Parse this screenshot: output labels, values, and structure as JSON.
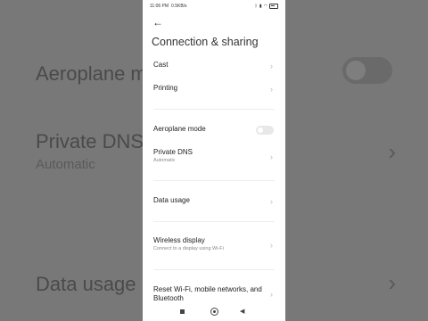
{
  "background": {
    "aeroplane_mode": "Aeroplane m",
    "private_dns": "Private DNS",
    "private_dns_value": "Automatic",
    "data_usage": "Data usage"
  },
  "status_bar": {
    "time": "11:06 PM",
    "speed": "0.5KB/s"
  },
  "header": {
    "back_icon": "←",
    "title": "Connection & sharing"
  },
  "items": [
    {
      "label": "Cast"
    },
    {
      "label": "Printing"
    },
    {
      "label": "Aeroplane mode",
      "toggle": false
    },
    {
      "label": "Private DNS",
      "sub": "Automatic"
    },
    {
      "label": "Data usage"
    },
    {
      "label": "Wireless display",
      "sub": "Connect to a display using Wi-Fi"
    },
    {
      "label": "Reset Wi-Fi, mobile networks, and",
      "label2": "Bluetooth"
    }
  ],
  "nav": {
    "back_glyph": "◀"
  }
}
